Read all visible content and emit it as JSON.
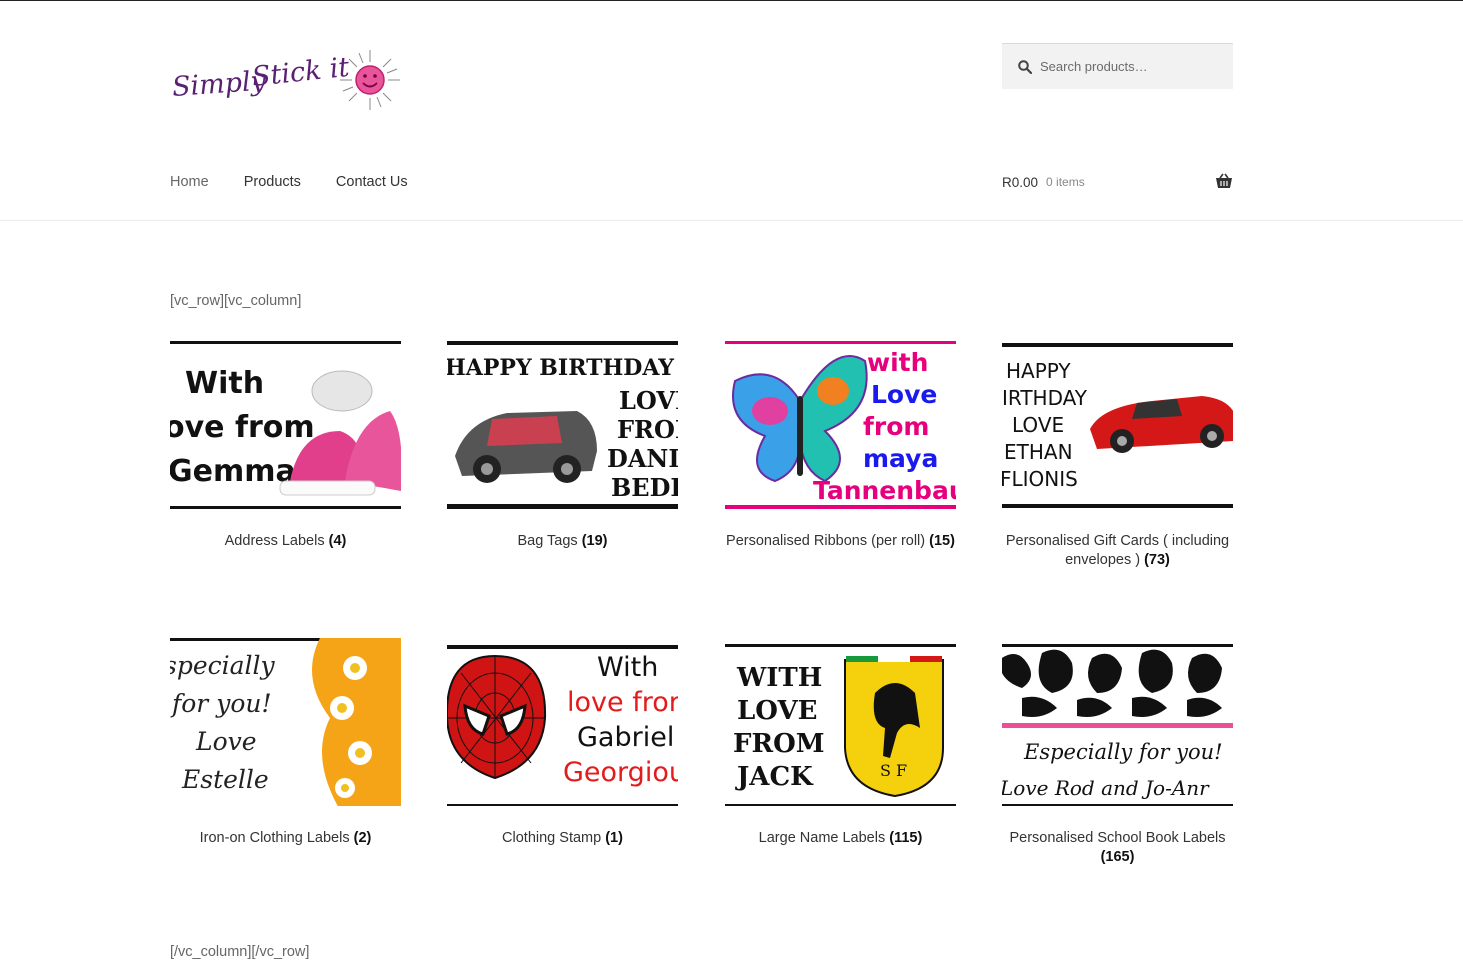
{
  "brand": {
    "name": "Simply Stick it"
  },
  "search": {
    "placeholder": "Search products…"
  },
  "nav": {
    "home": "Home",
    "products": "Products",
    "contact": "Contact Us"
  },
  "cart": {
    "amount": "R0.00",
    "items": "0 items"
  },
  "shortcode_open": "[vc_row][vc_column]",
  "shortcode_close": "[/vc_column][/vc_row]",
  "categories": [
    {
      "name": "Address Labels",
      "count": "(4)",
      "image_text": [
        "With",
        "ove from",
        "Gemma"
      ]
    },
    {
      "name": "Bag Tags",
      "count": "(19)",
      "image_text": [
        "HAPPY BIRTHDAY",
        "LOVI",
        "FROI",
        "DANIE",
        "BEDE"
      ]
    },
    {
      "name": "Personalised Ribbons (per roll)",
      "count": "(15)",
      "image_text": [
        "with",
        "Love",
        "from",
        "maya",
        "Tannenbau"
      ]
    },
    {
      "name": "Personalised Gift Cards ( including envelopes )",
      "count": "(73)",
      "image_text": [
        "HAPPY",
        "IRTHDAY",
        "LOVE",
        "ETHAN",
        "FLIONIS"
      ]
    },
    {
      "name": "Iron-on Clothing Labels",
      "count": "(2)",
      "image_text": [
        "specially",
        "for you!",
        "Love",
        "Estelle"
      ]
    },
    {
      "name": "Clothing Stamp",
      "count": "(1)",
      "image_text": [
        "With",
        "love fror",
        "Gabriel",
        "Georgiou"
      ]
    },
    {
      "name": "Large Name Labels",
      "count": "(115)",
      "image_text": [
        "WITH",
        "LOVE",
        "FROM",
        "JACK"
      ]
    },
    {
      "name": "Personalised School Book Labels",
      "count": "(165)",
      "image_text": [
        "Especially for you!",
        "Love Rod and Jo-Anr"
      ]
    }
  ],
  "colors": {
    "accent_pink": "#e6007e",
    "logo_purple": "#6b1e7a",
    "red": "#d91c1c"
  }
}
